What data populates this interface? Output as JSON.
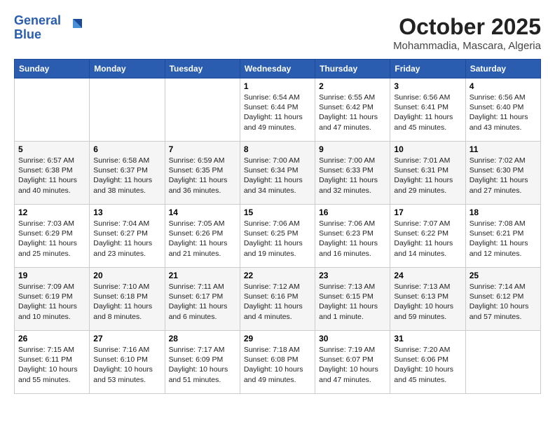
{
  "header": {
    "logo_line1": "General",
    "logo_line2": "Blue",
    "title": "October 2025",
    "subtitle": "Mohammadia, Mascara, Algeria"
  },
  "days_of_week": [
    "Sunday",
    "Monday",
    "Tuesday",
    "Wednesday",
    "Thursday",
    "Friday",
    "Saturday"
  ],
  "weeks": [
    [
      {
        "day": "",
        "detail": ""
      },
      {
        "day": "",
        "detail": ""
      },
      {
        "day": "",
        "detail": ""
      },
      {
        "day": "1",
        "detail": "Sunrise: 6:54 AM\nSunset: 6:44 PM\nDaylight: 11 hours\nand 49 minutes."
      },
      {
        "day": "2",
        "detail": "Sunrise: 6:55 AM\nSunset: 6:42 PM\nDaylight: 11 hours\nand 47 minutes."
      },
      {
        "day": "3",
        "detail": "Sunrise: 6:56 AM\nSunset: 6:41 PM\nDaylight: 11 hours\nand 45 minutes."
      },
      {
        "day": "4",
        "detail": "Sunrise: 6:56 AM\nSunset: 6:40 PM\nDaylight: 11 hours\nand 43 minutes."
      }
    ],
    [
      {
        "day": "5",
        "detail": "Sunrise: 6:57 AM\nSunset: 6:38 PM\nDaylight: 11 hours\nand 40 minutes."
      },
      {
        "day": "6",
        "detail": "Sunrise: 6:58 AM\nSunset: 6:37 PM\nDaylight: 11 hours\nand 38 minutes."
      },
      {
        "day": "7",
        "detail": "Sunrise: 6:59 AM\nSunset: 6:35 PM\nDaylight: 11 hours\nand 36 minutes."
      },
      {
        "day": "8",
        "detail": "Sunrise: 7:00 AM\nSunset: 6:34 PM\nDaylight: 11 hours\nand 34 minutes."
      },
      {
        "day": "9",
        "detail": "Sunrise: 7:00 AM\nSunset: 6:33 PM\nDaylight: 11 hours\nand 32 minutes."
      },
      {
        "day": "10",
        "detail": "Sunrise: 7:01 AM\nSunset: 6:31 PM\nDaylight: 11 hours\nand 29 minutes."
      },
      {
        "day": "11",
        "detail": "Sunrise: 7:02 AM\nSunset: 6:30 PM\nDaylight: 11 hours\nand 27 minutes."
      }
    ],
    [
      {
        "day": "12",
        "detail": "Sunrise: 7:03 AM\nSunset: 6:29 PM\nDaylight: 11 hours\nand 25 minutes."
      },
      {
        "day": "13",
        "detail": "Sunrise: 7:04 AM\nSunset: 6:27 PM\nDaylight: 11 hours\nand 23 minutes."
      },
      {
        "day": "14",
        "detail": "Sunrise: 7:05 AM\nSunset: 6:26 PM\nDaylight: 11 hours\nand 21 minutes."
      },
      {
        "day": "15",
        "detail": "Sunrise: 7:06 AM\nSunset: 6:25 PM\nDaylight: 11 hours\nand 19 minutes."
      },
      {
        "day": "16",
        "detail": "Sunrise: 7:06 AM\nSunset: 6:23 PM\nDaylight: 11 hours\nand 16 minutes."
      },
      {
        "day": "17",
        "detail": "Sunrise: 7:07 AM\nSunset: 6:22 PM\nDaylight: 11 hours\nand 14 minutes."
      },
      {
        "day": "18",
        "detail": "Sunrise: 7:08 AM\nSunset: 6:21 PM\nDaylight: 11 hours\nand 12 minutes."
      }
    ],
    [
      {
        "day": "19",
        "detail": "Sunrise: 7:09 AM\nSunset: 6:19 PM\nDaylight: 11 hours\nand 10 minutes."
      },
      {
        "day": "20",
        "detail": "Sunrise: 7:10 AM\nSunset: 6:18 PM\nDaylight: 11 hours\nand 8 minutes."
      },
      {
        "day": "21",
        "detail": "Sunrise: 7:11 AM\nSunset: 6:17 PM\nDaylight: 11 hours\nand 6 minutes."
      },
      {
        "day": "22",
        "detail": "Sunrise: 7:12 AM\nSunset: 6:16 PM\nDaylight: 11 hours\nand 4 minutes."
      },
      {
        "day": "23",
        "detail": "Sunrise: 7:13 AM\nSunset: 6:15 PM\nDaylight: 11 hours\nand 1 minute."
      },
      {
        "day": "24",
        "detail": "Sunrise: 7:13 AM\nSunset: 6:13 PM\nDaylight: 10 hours\nand 59 minutes."
      },
      {
        "day": "25",
        "detail": "Sunrise: 7:14 AM\nSunset: 6:12 PM\nDaylight: 10 hours\nand 57 minutes."
      }
    ],
    [
      {
        "day": "26",
        "detail": "Sunrise: 7:15 AM\nSunset: 6:11 PM\nDaylight: 10 hours\nand 55 minutes."
      },
      {
        "day": "27",
        "detail": "Sunrise: 7:16 AM\nSunset: 6:10 PM\nDaylight: 10 hours\nand 53 minutes."
      },
      {
        "day": "28",
        "detail": "Sunrise: 7:17 AM\nSunset: 6:09 PM\nDaylight: 10 hours\nand 51 minutes."
      },
      {
        "day": "29",
        "detail": "Sunrise: 7:18 AM\nSunset: 6:08 PM\nDaylight: 10 hours\nand 49 minutes."
      },
      {
        "day": "30",
        "detail": "Sunrise: 7:19 AM\nSunset: 6:07 PM\nDaylight: 10 hours\nand 47 minutes."
      },
      {
        "day": "31",
        "detail": "Sunrise: 7:20 AM\nSunset: 6:06 PM\nDaylight: 10 hours\nand 45 minutes."
      },
      {
        "day": "",
        "detail": ""
      }
    ]
  ]
}
